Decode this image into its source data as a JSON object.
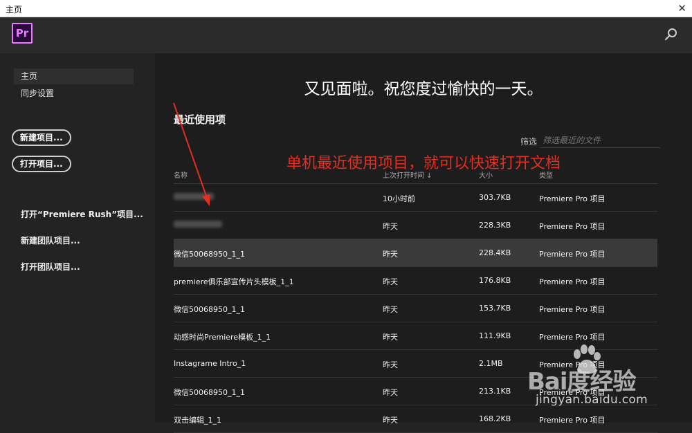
{
  "window": {
    "title": "主页",
    "close_label": "✕"
  },
  "app": {
    "logo_text": "Pr",
    "accent_color": "#e77cff"
  },
  "sidebar": {
    "nav": [
      {
        "label": "主页"
      },
      {
        "label": "同步设置"
      }
    ],
    "new_project_label": "新建项目...",
    "open_project_label": "打开项目...",
    "links": [
      {
        "label": "打开“Premiere Rush”项目..."
      },
      {
        "label": "新建团队项目..."
      },
      {
        "label": "打开团队项目..."
      }
    ]
  },
  "main": {
    "greeting": "又见面啦。祝您度过愉快的一天。",
    "recent_title": "最近使用项",
    "filter_label": "筛选",
    "filter_placeholder": "筛选最近的文件",
    "annotation": "单机最近使用项目，就可以快速打开文档",
    "table": {
      "headers": {
        "name": "名称",
        "time": "上次打开时间 ↓",
        "size": "大小",
        "type": "类型"
      },
      "rows": [
        {
          "name": "",
          "time": "10小时前",
          "size": "303.7KB",
          "type": "Premiere Pro 项目"
        },
        {
          "name": "",
          "time": "昨天",
          "size": "228.3KB",
          "type": "Premiere Pro 项目"
        },
        {
          "name": "微信50068950_1_1",
          "time": "昨天",
          "size": "228.4KB",
          "type": "Premiere Pro 项目"
        },
        {
          "name": "premiere俱乐部宣传片头模板_1_1",
          "time": "昨天",
          "size": "176.8KB",
          "type": "Premiere Pro 项目"
        },
        {
          "name": "微信50068950_1_1",
          "time": "昨天",
          "size": "153.7KB",
          "type": "Premiere Pro 项目"
        },
        {
          "name": "动感时尚Premiere模板_1_1",
          "time": "昨天",
          "size": "111.9KB",
          "type": "Premiere Pro 项目"
        },
        {
          "name": "Instagrame Intro_1",
          "time": "昨天",
          "size": "2.1MB",
          "type": "Premiere Pro 项目"
        },
        {
          "name": "微信50068950_1_1",
          "time": "昨天",
          "size": "213.1KB",
          "type": "Premiere Pro 项目"
        },
        {
          "name": "双击编辑_1_1",
          "time": "昨天",
          "size": "168.2KB",
          "type": "Premiere Pro 项目"
        }
      ]
    }
  },
  "watermark": {
    "logo": "Bai度经验",
    "url": "jingyan.baidu.com"
  }
}
